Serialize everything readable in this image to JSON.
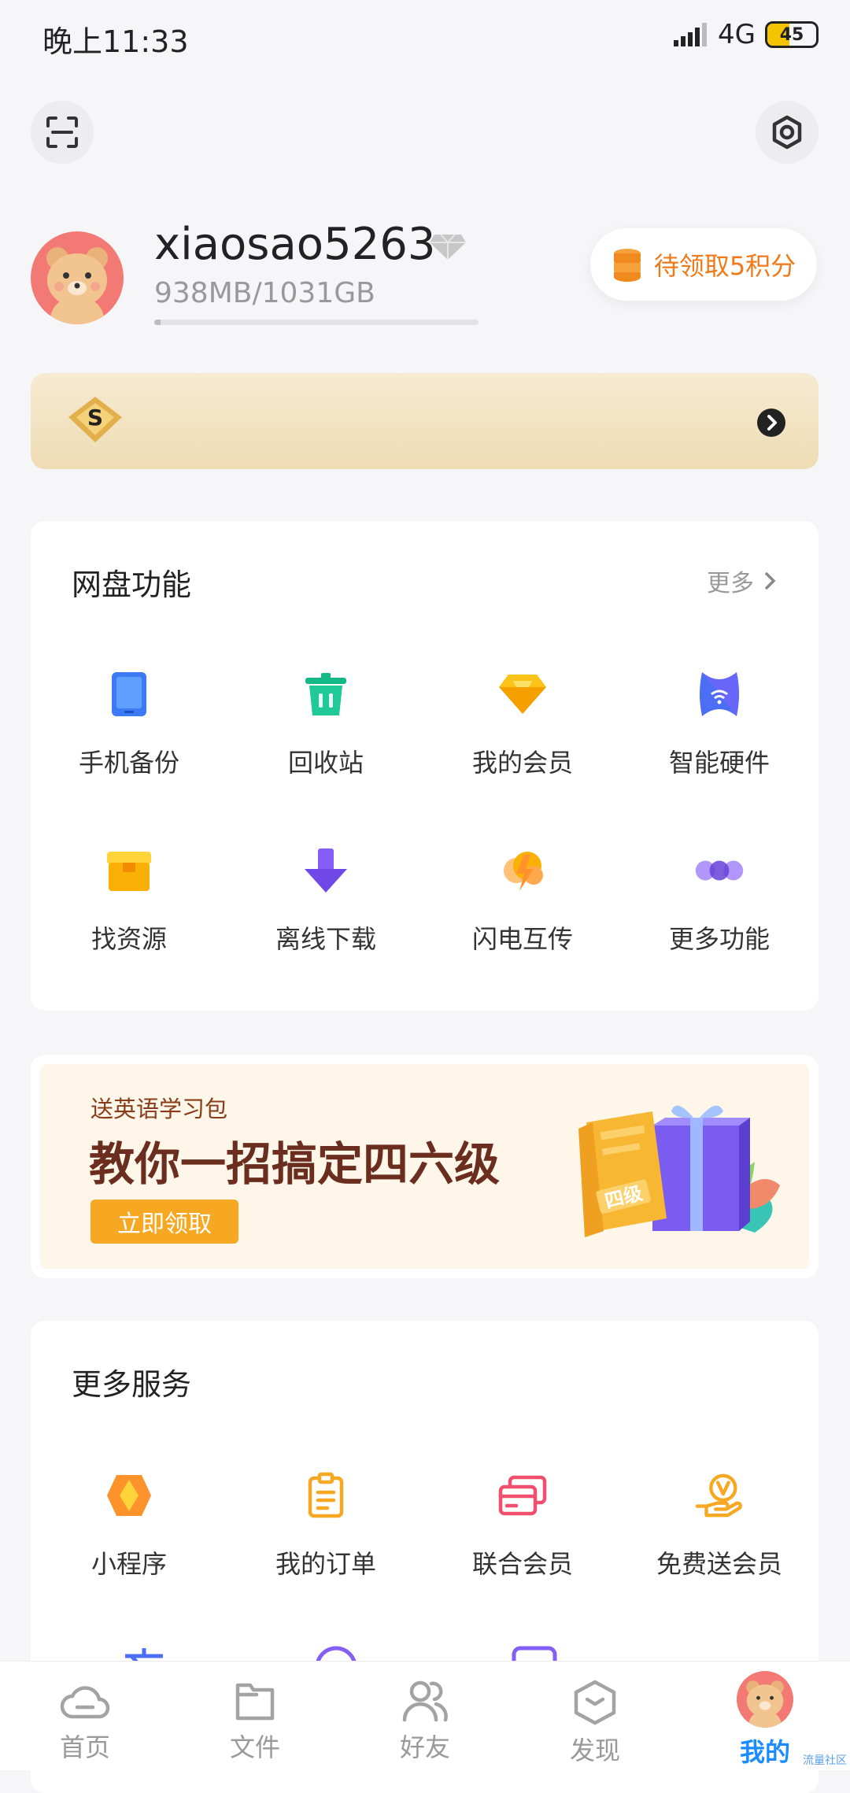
{
  "status": {
    "time": "晚上11:33",
    "network": "4G",
    "battery": "45",
    "battery_level": 0.45
  },
  "profile": {
    "username": "xiaosao5263",
    "storage": "938MB/1031GB",
    "storage_used_fraction": 0.01,
    "points_label": "待领取5积分"
  },
  "features": {
    "title": "网盘功能",
    "more_label": "更多",
    "items": [
      {
        "label": "手机备份",
        "icon": "phone-backup-icon"
      },
      {
        "label": "回收站",
        "icon": "recycle-bin-icon"
      },
      {
        "label": "我的会员",
        "icon": "membership-icon"
      },
      {
        "label": "智能硬件",
        "icon": "smart-hardware-icon"
      },
      {
        "label": "找资源",
        "icon": "find-resources-icon"
      },
      {
        "label": "离线下载",
        "icon": "offline-download-icon"
      },
      {
        "label": "闪电互传",
        "icon": "lightning-transfer-icon"
      },
      {
        "label": "更多功能",
        "icon": "more-features-icon"
      }
    ]
  },
  "promo": {
    "tag": "送英语学习包",
    "headline": "教你一招搞定四六级",
    "button": "立即领取",
    "book_label": "四级"
  },
  "services": {
    "title": "更多服务",
    "items": [
      {
        "label": "小程序",
        "icon": "mini-program-icon"
      },
      {
        "label": "我的订单",
        "icon": "orders-icon"
      },
      {
        "label": "联合会员",
        "icon": "joint-membership-icon"
      },
      {
        "label": "免费送会员",
        "icon": "free-membership-icon"
      }
    ]
  },
  "nav": {
    "items": [
      {
        "label": "首页",
        "icon": "cloud-icon"
      },
      {
        "label": "文件",
        "icon": "folder-icon"
      },
      {
        "label": "好友",
        "icon": "friends-icon"
      },
      {
        "label": "发现",
        "icon": "discover-icon"
      },
      {
        "label": "我的",
        "icon": "avatar"
      }
    ],
    "active_color": "#1a8cff",
    "watermark": "流量社区"
  },
  "colors": {
    "accent": "#f07a1a",
    "primary": "#1a8cff",
    "promo_button": "#f7a823"
  }
}
